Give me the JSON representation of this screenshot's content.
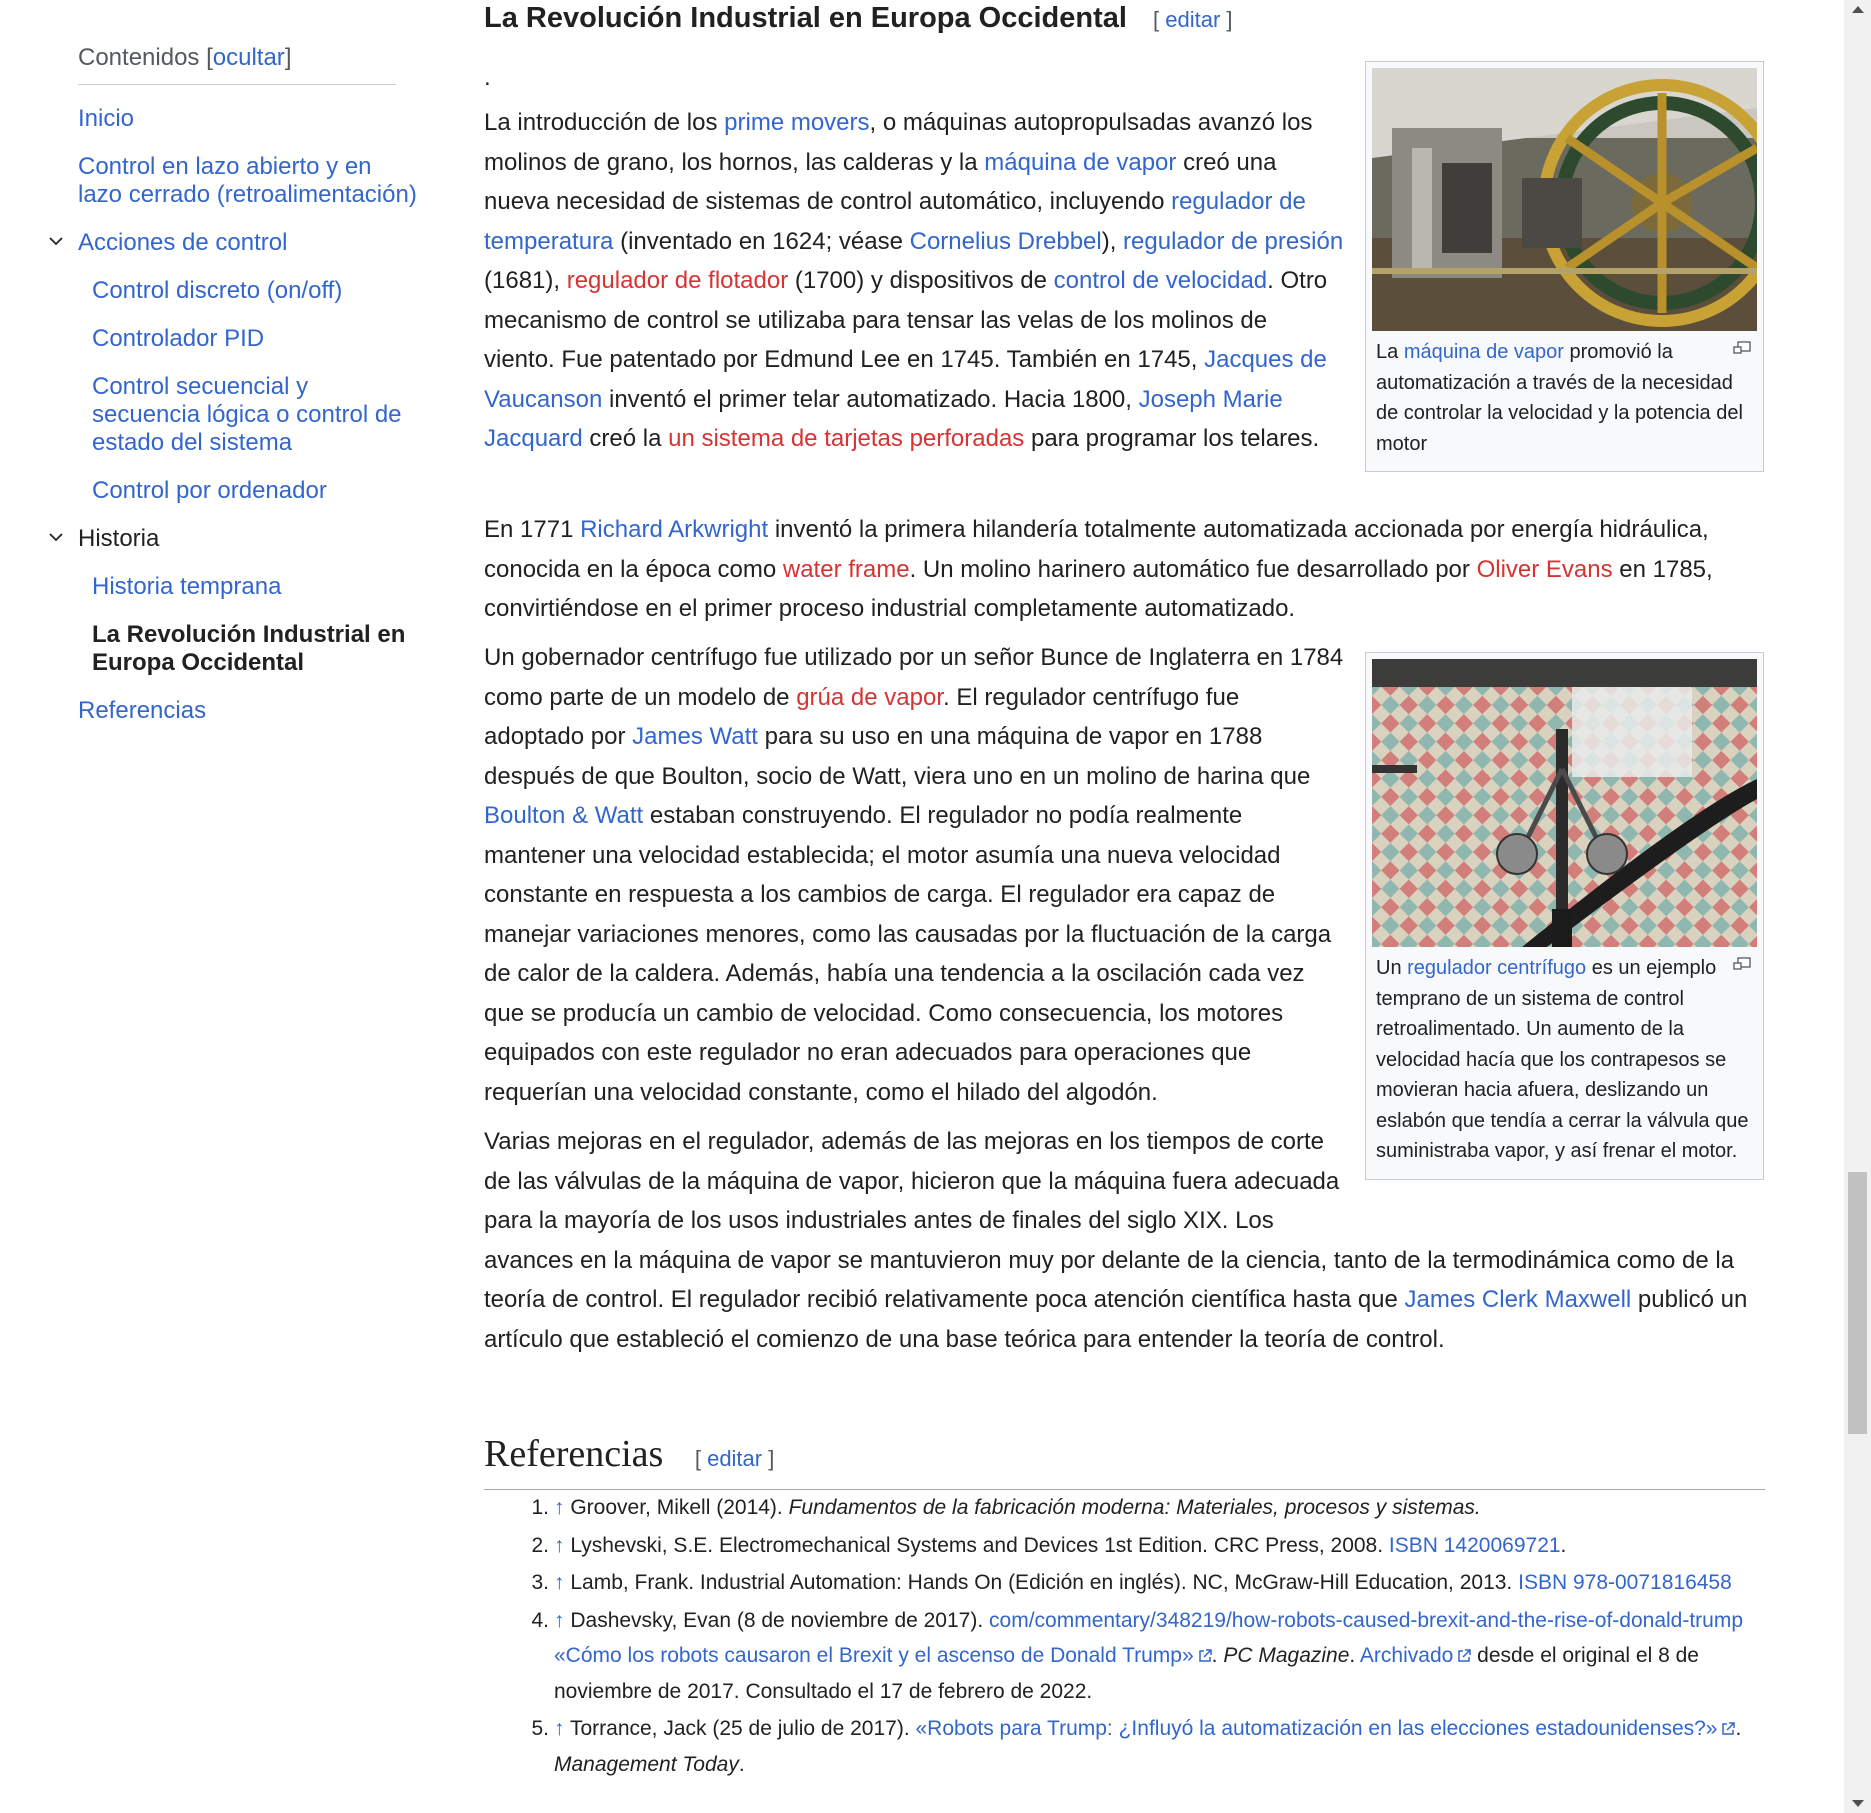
{
  "toc": {
    "title": "Contenidos",
    "hide_label": "ocultar",
    "items": [
      {
        "label": "Inicio"
      },
      {
        "label": "Control en lazo abierto y en lazo cerrado (retroalimentación)"
      },
      {
        "label": "Acciones de control"
      },
      {
        "label": "Control discreto (on/off)"
      },
      {
        "label": "Controlador PID"
      },
      {
        "label": "Control secuencial y secuencia lógica o control de estado del sistema"
      },
      {
        "label": "Control por ordenador"
      },
      {
        "label": "Historia"
      },
      {
        "label": "Historia temprana"
      },
      {
        "label": "La Revolución Industrial en Europa Occidental"
      },
      {
        "label": "Referencias"
      }
    ]
  },
  "section": {
    "title": "La Revolución Industrial en Europa Occidental",
    "edit_label": "editar",
    "dot": "."
  },
  "p1": {
    "t1": "La introducción de los ",
    "l1": "prime movers",
    "t2": ", o máquinas autopropulsadas avanzó los molinos de grano, los hornos, las calderas y la ",
    "l2": "máquina de vapor",
    "t3": " creó una nueva necesidad de sistemas de control automático, incluyendo ",
    "l3": "regulador de temperatura",
    "t4": " (inventado en 1624; véase ",
    "l4": "Cornelius Drebbel",
    "t5": "), ",
    "l5": "regulador de presión",
    "t6": " (1681), ",
    "l6": "regulador de flotador",
    "t7": " (1700) y dispositivos de ",
    "l7": "control de velocidad",
    "t8": ". Otro mecanismo de control se utilizaba para tensar las velas de los molinos de viento. Fue patentado por Edmund Lee en 1745. También en 1745, ",
    "l8": "Jacques de Vaucanson",
    "t9": " inventó el primer telar automatizado. Hacia 1800, ",
    "l9": "Joseph Marie Jacquard",
    "t10": " creó la ",
    "l10": "un sistema de tarjetas perforadas",
    "t11": " para programar los telares."
  },
  "p2": {
    "t1": "En 1771 ",
    "l1": "Richard Arkwright",
    "t2": " inventó la primera hilandería totalmente automatizada accionada por energía hidráulica, conocida en la época como ",
    "l2": "water frame",
    "t3": ". Un molino harinero automático fue desarrollado por ",
    "l3": "Oliver Evans",
    "t4": " en 1785, convirtiéndose en el primer proceso industrial completamente automatizado."
  },
  "p3": {
    "t1": "Un gobernador centrífugo fue utilizado por un señor Bunce de Inglaterra en 1784 como parte de un modelo de ",
    "l1": "grúa de vapor",
    "t2": ". El regulador centrífugo fue adoptado por ",
    "l2": "James Watt",
    "t3": " para su uso en una máquina de vapor en 1788 después de que Boulton, socio de Watt, viera uno en un molino de harina que ",
    "l3": "Boulton & Watt",
    "t4": " estaban construyendo. El regulador no podía realmente mantener una velocidad establecida; el motor asumía una nueva velocidad constante en respuesta a los cambios de carga. El regulador era capaz de manejar variaciones menores, como las causadas por la fluctuación de la carga de calor de la caldera. Además, había una tendencia a la oscilación cada vez que se producía un cambio de velocidad. Como consecuencia, los motores equipados con este regulador no eran adecuados para operaciones que requerían una velocidad constante, como el hilado del algodón."
  },
  "p4": {
    "t1": "Varias mejoras en el regulador, además de las mejoras en los tiempos de corte de las válvulas de la máquina de vapor, hicieron que la máquina fuera adecuada para la mayoría de los usos industriales antes de finales del siglo XIX. Los avances en la máquina de vapor se mantuvieron muy por delante de la ciencia, tanto de la termodinámica como de la teoría de control. El regulador recibió relativamente poca atención científica hasta que ",
    "l1": "James Clerk Maxwell",
    "t2": " publicó un artículo que estableció el comienzo de una base teórica para entender la teoría de control."
  },
  "fig1": {
    "c1": "La ",
    "l1": "máquina de vapor",
    "c2": " promovió la automatización a través de la necesidad de controlar la velocidad y la potencia del motor"
  },
  "fig2": {
    "c1": "Un ",
    "l1": "regulador centrífugo",
    "c2": " es un ejemplo temprano de un sistema de control retroalimentado. Un aumento de la velocidad hacía que los contrapesos se movieran hacia afuera, deslizando un eslabón que tendía a cerrar la válvula que suministraba vapor, y así frenar el motor."
  },
  "refs": {
    "title": "Referencias",
    "edit_label": "editar",
    "arrow": "↑",
    "items": [
      {
        "num": "1.",
        "text": "Groover, Mikell (2014). ",
        "italic": "Fundamentos de la fabricación moderna: Materiales, procesos y sistemas."
      },
      {
        "num": "2.",
        "text": "Lyshevski, S.E. Electromechanical Systems and Devices 1st Edition. CRC Press, 2008. ",
        "link": "ISBN 1420069721",
        "after": "."
      },
      {
        "num": "3.",
        "text": "Lamb, Frank. Industrial Automation: Hands On (Edición en inglés). NC, McGraw-Hill Education, 2013. ",
        "link": "ISBN 978-0071816458"
      },
      {
        "num": "4.",
        "text": "Dashevsky, Evan (8 de noviembre de 2017). ",
        "link": "com/commentary/348219/how-robots-caused-brexit-and-the-rise-of-donald-trump «Cómo los robots causaron el Brexit y el ascenso de Donald Trump»",
        "mid": ". ",
        "italic": "PC Magazine",
        "mid2": ". ",
        "link2": "Archivado",
        "after": " desde el original el 8 de noviembre de 2017. Consultado el 17 de febrero de 2022."
      },
      {
        "num": "5.",
        "text": "Torrance, Jack (25 de julio de 2017). ",
        "link": "«Robots para Trump: ¿Influyó la automatización en las elecciones estadounidenses?»",
        "mid": ". ",
        "italic": "Management Today",
        "after": "."
      }
    ]
  },
  "colors": {
    "link": "#3366cc",
    "redlink": "#d73333",
    "text": "#202122"
  }
}
